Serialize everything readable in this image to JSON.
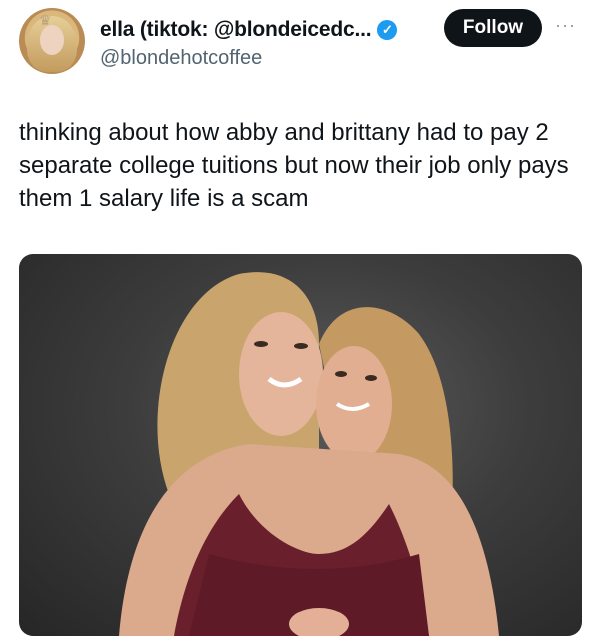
{
  "tweet": {
    "author": {
      "display_name": "ella (tiktok: @blondeicedc...",
      "handle": "@blondehotcoffee",
      "verified": true,
      "avatar_icon": "profile-photo"
    },
    "actions": {
      "follow_label": "Follow",
      "more_label": "···"
    },
    "text": "thinking about how abby and brittany had to pay 2 separate college tuitions but now their job only pays them 1 salary life is a scam",
    "media": {
      "type": "photo",
      "icon": "image-photo"
    }
  },
  "colors": {
    "verified_blue": "#1d9bf0",
    "button_black": "#0f1419",
    "handle_gray": "#536471"
  }
}
